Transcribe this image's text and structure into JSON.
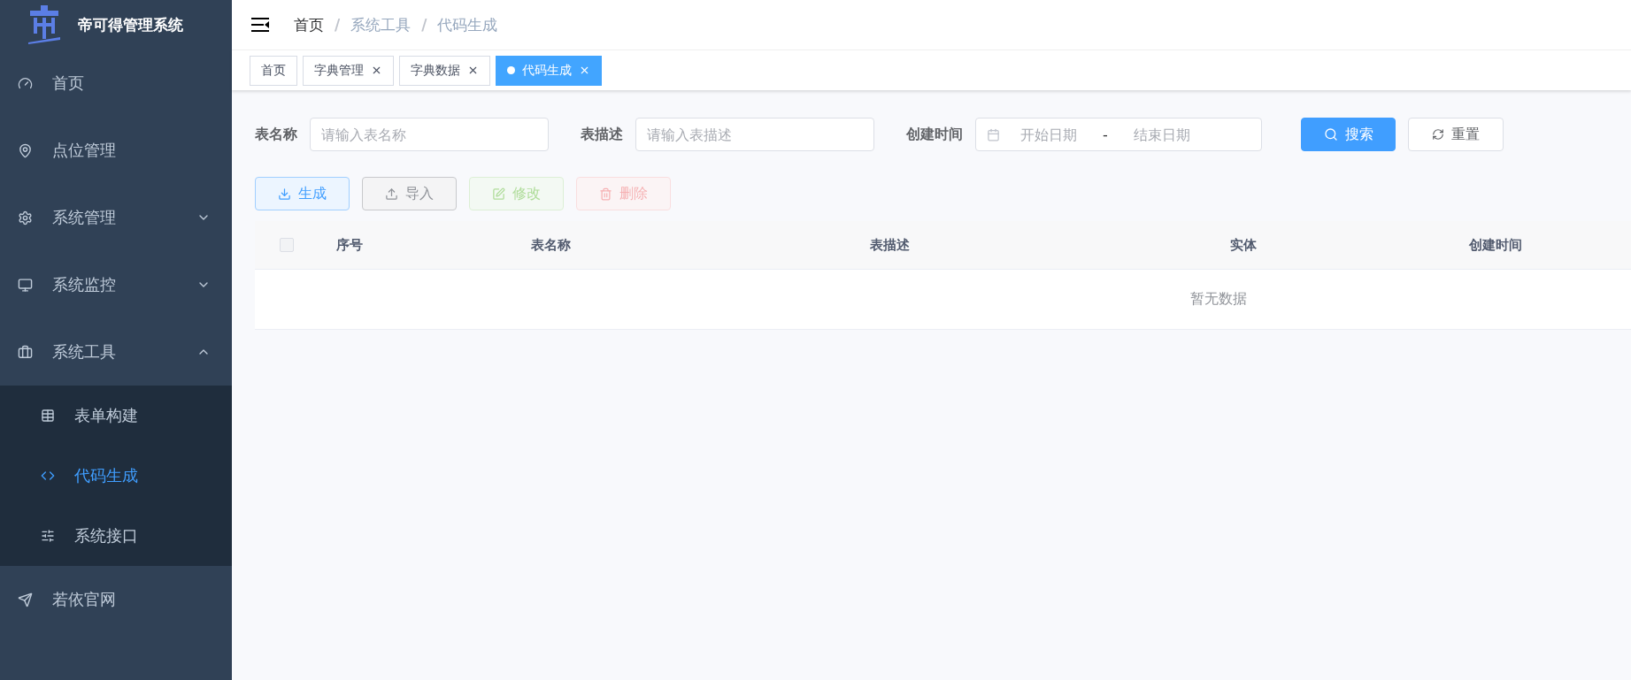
{
  "sidebar": {
    "title": "帝可得管理系统",
    "items": [
      {
        "label": "首页",
        "selected": false
      },
      {
        "label": "点位管理",
        "selected": false
      },
      {
        "label": "系统管理",
        "selected": false,
        "expanded": false
      },
      {
        "label": "系统监控",
        "selected": false,
        "expanded": false
      },
      {
        "label": "系统工具",
        "selected": false,
        "expanded": true,
        "children": [
          {
            "label": "表单构建",
            "selected": false
          },
          {
            "label": "代码生成",
            "selected": true
          },
          {
            "label": "系统接口",
            "selected": false
          }
        ]
      },
      {
        "label": "若依官网",
        "selected": false
      }
    ]
  },
  "breadcrumb": {
    "items": [
      "首页",
      "系统工具",
      "代码生成"
    ],
    "separators": [
      "/",
      "/"
    ]
  },
  "tabs": [
    {
      "label": "首页",
      "selected": false,
      "closable": false
    },
    {
      "label": "字典管理",
      "selected": false,
      "closable": true
    },
    {
      "label": "字典数据",
      "selected": false,
      "closable": true
    },
    {
      "label": "代码生成",
      "selected": true,
      "closable": true
    }
  ],
  "filters": [
    {
      "kind": "text",
      "label": "表名称",
      "placeholder": "请输入表名称"
    },
    {
      "kind": "text",
      "label": "表描述",
      "placeholder": "请输入表描述"
    },
    {
      "kind": "daterange",
      "label": "创建时间",
      "start_placeholder": "开始日期",
      "separator": "-",
      "end_placeholder": "结束日期"
    }
  ],
  "search_button": "搜索",
  "reset_button": "重置",
  "actions": [
    {
      "label": "生成",
      "kind": "primary",
      "disabled": false
    },
    {
      "label": "导入",
      "kind": "info",
      "disabled": false
    },
    {
      "label": "修改",
      "kind": "success",
      "disabled": true
    },
    {
      "label": "删除",
      "kind": "danger",
      "disabled": true
    }
  ],
  "table": {
    "select_all_checked": false,
    "columns": [
      "序号",
      "表名称",
      "表描述",
      "实体",
      "创建时间"
    ],
    "empty_text": "暂无数据"
  }
}
